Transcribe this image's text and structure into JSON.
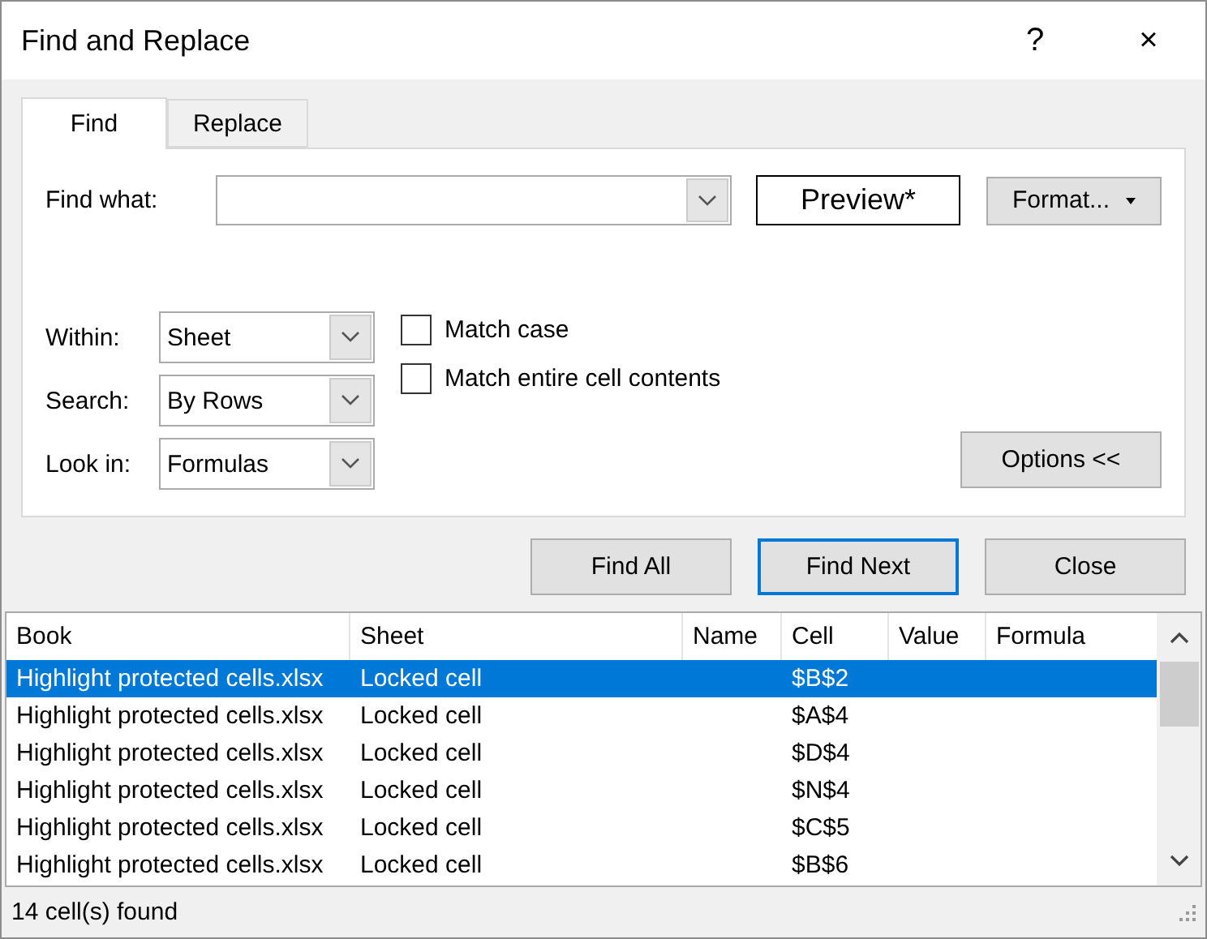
{
  "window": {
    "title": "Find and Replace",
    "help": "?",
    "close": "×"
  },
  "tabs": [
    {
      "label": "Find",
      "selected": true
    },
    {
      "label": "Replace",
      "selected": false
    }
  ],
  "find_what": {
    "label": "Find what:"
  },
  "preview": "Preview*",
  "format_button": "Format...",
  "options": [
    {
      "label": "Within:",
      "value": "Sheet"
    },
    {
      "label": "Search:",
      "value": "By Rows"
    },
    {
      "label": "Look in:",
      "value": "Formulas"
    }
  ],
  "checkboxes": [
    {
      "label": "Match case",
      "checked": false
    },
    {
      "label": "Match entire cell contents",
      "checked": false
    }
  ],
  "options_button": "Options <<",
  "buttons": [
    {
      "label": "Find All",
      "default": false
    },
    {
      "label": "Find Next",
      "default": true
    },
    {
      "label": "Close",
      "default": false
    }
  ],
  "table": {
    "columns": [
      "Book",
      "Sheet",
      "Name",
      "Cell",
      "Value",
      "Formula"
    ],
    "rows": [
      {
        "cells": [
          "Highlight protected cells.xlsx",
          "Locked cell",
          "",
          "$B$2",
          "",
          ""
        ],
        "selected": true
      },
      {
        "cells": [
          "Highlight protected cells.xlsx",
          "Locked cell",
          "",
          "$A$4",
          "",
          ""
        ],
        "selected": false
      },
      {
        "cells": [
          "Highlight protected cells.xlsx",
          "Locked cell",
          "",
          "$D$4",
          "",
          ""
        ],
        "selected": false
      },
      {
        "cells": [
          "Highlight protected cells.xlsx",
          "Locked cell",
          "",
          "$N$4",
          "",
          ""
        ],
        "selected": false
      },
      {
        "cells": [
          "Highlight protected cells.xlsx",
          "Locked cell",
          "",
          "$C$5",
          "",
          ""
        ],
        "selected": false
      },
      {
        "cells": [
          "Highlight protected cells.xlsx",
          "Locked cell",
          "",
          "$B$6",
          "",
          ""
        ],
        "selected": false
      }
    ]
  },
  "status_bar": "14 cell(s) found"
}
